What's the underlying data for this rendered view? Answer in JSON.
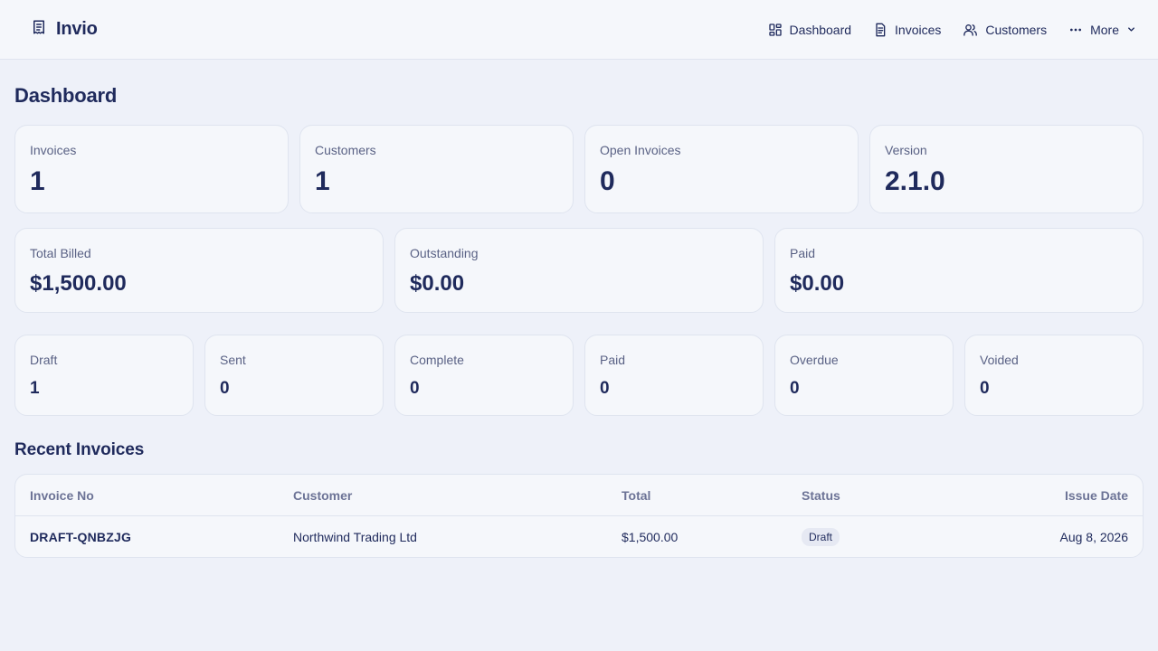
{
  "app": {
    "name": "Invio"
  },
  "nav": {
    "dashboard": "Dashboard",
    "invoices": "Invoices",
    "customers": "Customers",
    "more": "More"
  },
  "page": {
    "title": "Dashboard"
  },
  "stats_row1": [
    {
      "label": "Invoices",
      "value": "1"
    },
    {
      "label": "Customers",
      "value": "1"
    },
    {
      "label": "Open Invoices",
      "value": "0"
    },
    {
      "label": "Version",
      "value": "2.1.0"
    }
  ],
  "stats_row2": [
    {
      "label": "Total Billed",
      "value": "$1,500.00"
    },
    {
      "label": "Outstanding",
      "value": "$0.00"
    },
    {
      "label": "Paid",
      "value": "$0.00"
    }
  ],
  "stats_row3": [
    {
      "label": "Draft",
      "value": "1"
    },
    {
      "label": "Sent",
      "value": "0"
    },
    {
      "label": "Complete",
      "value": "0"
    },
    {
      "label": "Paid",
      "value": "0"
    },
    {
      "label": "Overdue",
      "value": "0"
    },
    {
      "label": "Voided",
      "value": "0"
    }
  ],
  "recent": {
    "title": "Recent Invoices",
    "columns": [
      "Invoice No",
      "Customer",
      "Total",
      "Status",
      "Issue Date"
    ],
    "rows": [
      {
        "invoice_no": "DRAFT-QNBZJG",
        "customer": "Northwind Trading Ltd",
        "total": "$1,500.00",
        "status": "Draft",
        "issue_date": "Aug 8, 2026"
      }
    ]
  },
  "icons": {
    "brand": "receipt-icon",
    "dashboard": "grid-icon",
    "invoices": "document-icon",
    "customers": "users-icon",
    "more": "dots-horizontal-icon",
    "more_chevron": "chevron-down-icon"
  },
  "colors": {
    "text": "#1f2a5c",
    "muted": "#5a6285",
    "background": "#eef1f9",
    "card": "#f5f7fb",
    "border": "#dfe4ef"
  }
}
